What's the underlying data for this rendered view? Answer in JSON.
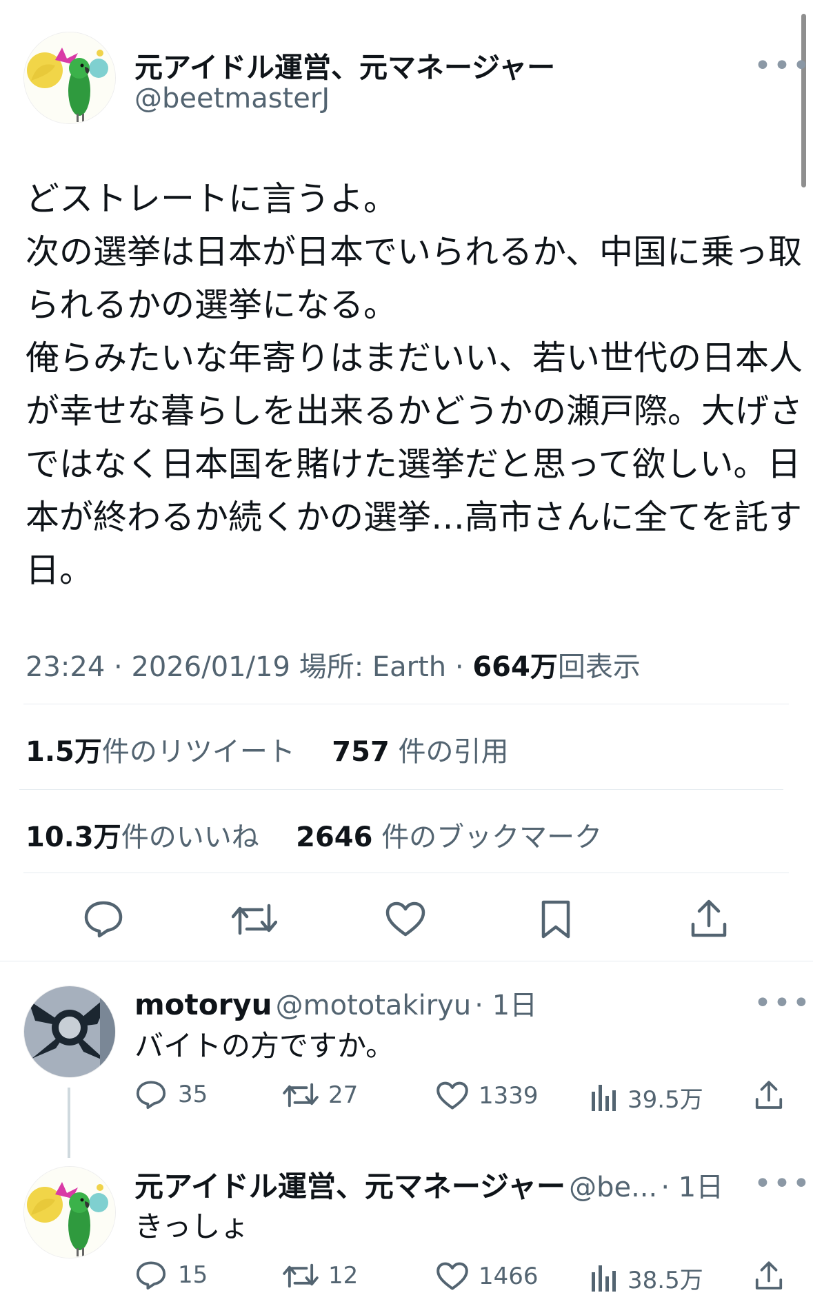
{
  "main_tweet": {
    "display_name": "元アイドル運営、元マネージャー",
    "handle": "@beetmasterJ",
    "more": "•••",
    "text_lines": [
      "どストレートに言うよ。",
      "次の選挙は日本が日本でいられるか、中国に乗っ取",
      "られるかの選挙になる。",
      "俺らみたいな年寄りはまだいい、若い世代の日本人",
      "が幸せな暮らしを出来るかどうかの瀬戸際。大げさ",
      "ではなく日本国を賭けた選挙だと思って欲しい。日",
      "本が終わるか続くかの選挙…高市さんに全てを託す",
      "日。"
    ],
    "time": "23:24",
    "date": "2026/01/19",
    "location": "場所: Earth",
    "views_count": "664万",
    "views_label": "回表示",
    "retweets_count": "1.5万",
    "retweets_label": "件のリツイート",
    "quotes_count": "757",
    "quotes_label": "件の引用",
    "likes_count": "10.3万",
    "likes_label": "件のいいね",
    "bookmarks_count": "2646",
    "bookmarks_label": "件のブックマーク"
  },
  "replies": [
    {
      "display_name": "motoryu",
      "handle": "@mototakiryu",
      "time": "1日",
      "text": "バイトの方ですか。",
      "reply_count": "35",
      "retweet_count": "27",
      "like_count": "1339",
      "view_count": "39.5万"
    },
    {
      "display_name": "元アイドル運営、元マネージャー",
      "handle": "@be...",
      "time": "1日",
      "text": "きっしょ",
      "reply_count": "15",
      "retweet_count": "12",
      "like_count": "1466",
      "view_count": "38.5万"
    }
  ],
  "icons": {
    "reply": "speech-bubble-icon",
    "retweet": "retweet-arrows-icon",
    "like": "heart-icon",
    "bookmark": "bookmark-icon",
    "share": "share-upload-icon",
    "views": "bar-chart-icon",
    "more": "ellipsis-icon"
  },
  "colors": {
    "text": "#0f1419",
    "secondary": "#536471",
    "divider": "#e6ecf0"
  }
}
